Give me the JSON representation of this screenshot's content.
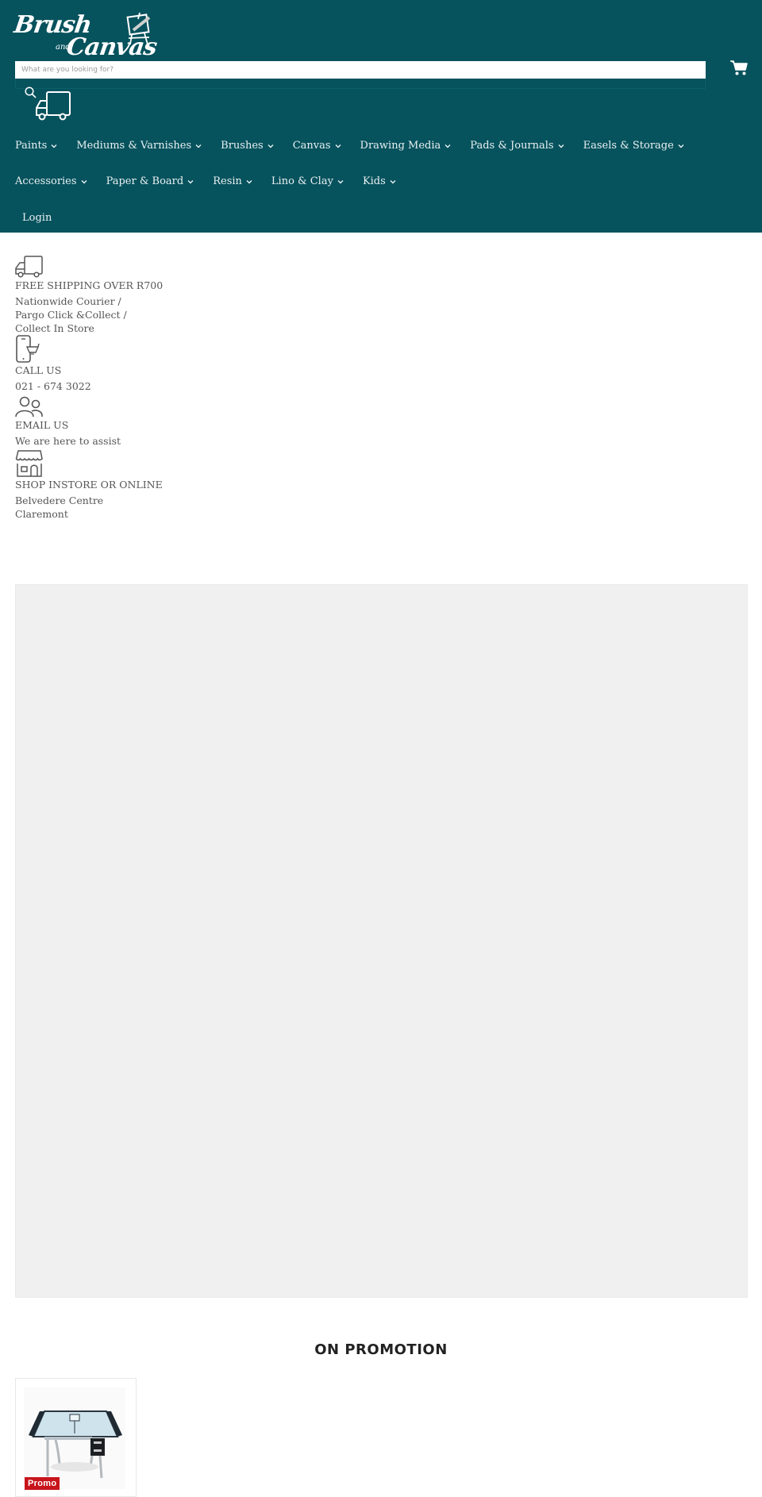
{
  "colors": {
    "header_bg": "#06525d",
    "hero_bg": "#f0f0f0",
    "promo_badge": "#c8141b"
  },
  "brand": {
    "logo_word1": "Brush",
    "logo_word2": "and",
    "logo_word3": "Canvas"
  },
  "search": {
    "placeholder": "What are you looking for?",
    "value": ""
  },
  "icons": {
    "search": "search-icon",
    "cart": "cart-icon",
    "truck": "truck-icon",
    "phone": "phone-icon",
    "users": "users-icon",
    "store": "store-icon"
  },
  "nav": {
    "row1": [
      {
        "label": "Paints"
      },
      {
        "label": "Mediums & Varnishes"
      },
      {
        "label": "Brushes"
      },
      {
        "label": "Canvas"
      },
      {
        "label": "Drawing Media"
      },
      {
        "label": "Pads & Journals"
      },
      {
        "label": "Easels & Storage"
      }
    ],
    "row2": [
      {
        "label": "Accessories"
      },
      {
        "label": "Paper & Board"
      },
      {
        "label": "Resin"
      },
      {
        "label": "Lino & Clay"
      },
      {
        "label": "Kids"
      }
    ],
    "login": "Login"
  },
  "features": [
    {
      "title": "FREE SHIPPING OVER R700",
      "lines": [
        "Nationwide Courier /",
        "Pargo Click &Collect /",
        "Collect In Store"
      ]
    },
    {
      "title": "CALL US",
      "lines": [
        "021 - 674 3022"
      ]
    },
    {
      "title": "EMAIL US",
      "lines": [
        "We are here to assist"
      ]
    },
    {
      "title": "SHOP INSTORE OR ONLINE",
      "lines": [
        "Belvedere Centre",
        "Claremont"
      ]
    }
  ],
  "promotions": {
    "heading": "ON PROMOTION",
    "products": [
      {
        "badge": "Promo",
        "image": "drafting-table"
      }
    ]
  }
}
